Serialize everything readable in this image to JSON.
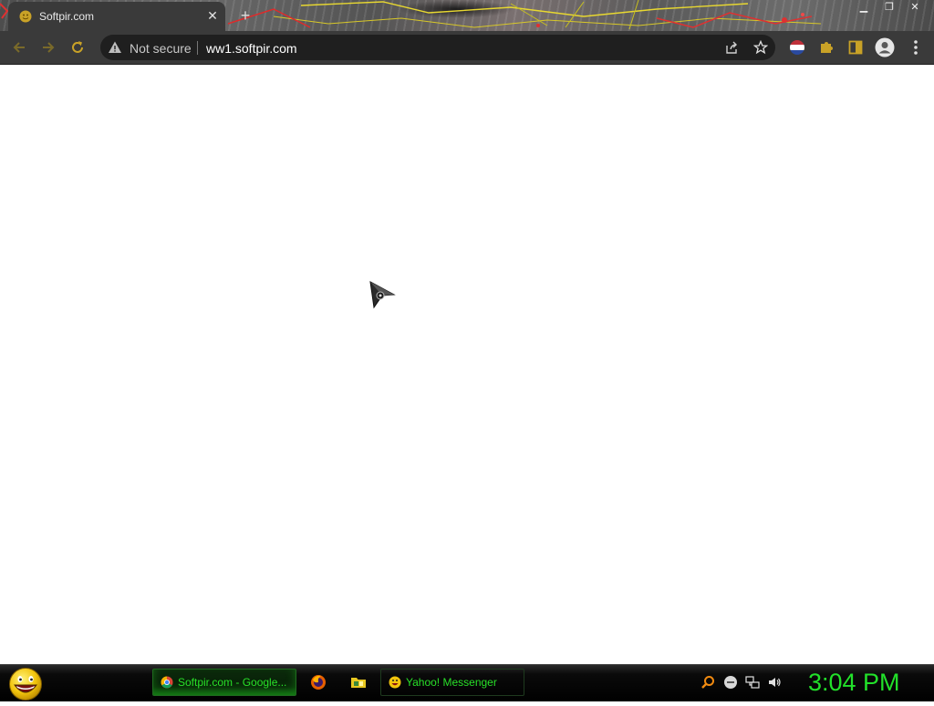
{
  "browser": {
    "tab": {
      "title": "Softpir.com",
      "close_icon": "close-icon",
      "favicon": "smiley-favicon-icon"
    },
    "new_tab_icon": "plus-icon",
    "window_controls": [
      "minimize-icon",
      "restore-icon",
      "close-icon"
    ],
    "toolbar": {
      "back_icon": "arrow-left-icon",
      "forward_icon": "arrow-right-icon",
      "reload_icon": "reload-icon",
      "security_label": "Not secure",
      "url": "ww1.softpir.com",
      "share_icon": "share-icon",
      "bookmark_icon": "star-icon",
      "extensions": [
        "flag-extension-icon",
        "puzzle-icon",
        "side-panel-icon",
        "profile-icon",
        "kebab-menu-icon"
      ]
    },
    "accent_color": "#c9a227"
  },
  "taskbar": {
    "start_icon": "smiley-start-icon",
    "items": [
      {
        "label": "Softpir.com - Google...",
        "icon": "chrome-icon",
        "active": true
      },
      {
        "label": "Yahoo! Messenger",
        "icon": "smiley-icon",
        "active": false
      }
    ],
    "quick_launch": [
      "firefox-icon",
      "folder-icon"
    ],
    "tray": [
      "search-icon",
      "messenger-status-icon",
      "network-icon",
      "volume-icon"
    ],
    "clock": "3:04 PM",
    "text_color": "#22e02a"
  }
}
